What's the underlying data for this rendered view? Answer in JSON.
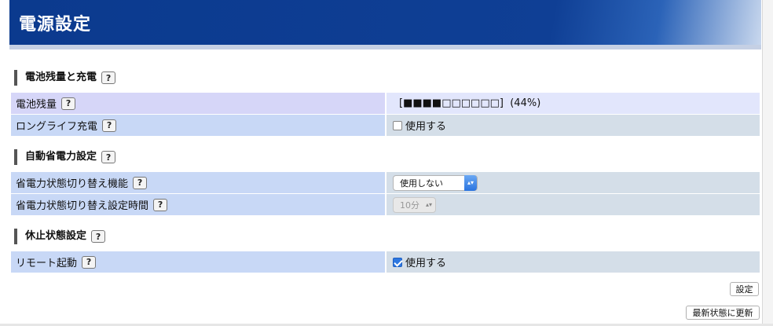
{
  "header": {
    "title": "電源設定"
  },
  "help_label": "?",
  "sections": {
    "battery": {
      "title": "電池残量と充電",
      "level_label": "電池残量",
      "level_value": "[■■■■□□□□□□]  (44%)",
      "level_percent": 44,
      "longlife_label": "ロングライフ充電",
      "longlife_option": "使用する",
      "longlife_checked": false
    },
    "auto_power": {
      "title": "自動省電力設定",
      "switch_label": "省電力状態切り替え機能",
      "switch_value": "使用しない",
      "time_label": "省電力状態切り替え設定時間",
      "time_value": "10分",
      "time_disabled": true
    },
    "suspend": {
      "title": "休止状態設定",
      "remote_label": "リモート起動",
      "remote_option": "使用する",
      "remote_checked": true
    }
  },
  "buttons": {
    "apply": "設定",
    "refresh": "最新状態に更新"
  },
  "colors": {
    "header": "#0f3f95",
    "label_row": "#c8d8f6",
    "value_row": "#d4dee8",
    "accent_check": "#2d77e0"
  }
}
